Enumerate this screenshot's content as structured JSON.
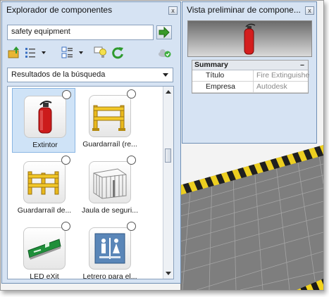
{
  "explorer": {
    "title": "Explorador de componentes",
    "close": "x",
    "search_value": "safety equipment",
    "dropdown_value": "Resultados de la búsqueda",
    "results": [
      {
        "label": "Extintor",
        "selected": true,
        "icon": "fire-extinguisher-icon"
      },
      {
        "label": "Guardarraíl (re...",
        "selected": false,
        "icon": "guardrail-icon"
      },
      {
        "label": "Guardarraíl de...",
        "selected": false,
        "icon": "guardrail-icon"
      },
      {
        "label": "Jaula de seguri...",
        "selected": false,
        "icon": "safety-cage-icon"
      },
      {
        "label": "LED eXit",
        "selected": false,
        "icon": "exit-sign-icon"
      },
      {
        "label": "Letrero para el...",
        "selected": false,
        "icon": "restroom-sign-icon"
      }
    ]
  },
  "preview": {
    "title": "Vista preliminar de compone...",
    "close": "x",
    "summary_header": "Summary",
    "collapse_symbol": "–",
    "properties": [
      {
        "key": "Título",
        "value": "Fire Extinguishe"
      },
      {
        "key": "Empresa",
        "value": "Autodesk"
      }
    ]
  },
  "colors": {
    "panel": "#d6e3f3",
    "selection": "#cfe3f7",
    "accent_green": "#3a9a2a",
    "hazard_yellow": "#f2d21b"
  }
}
